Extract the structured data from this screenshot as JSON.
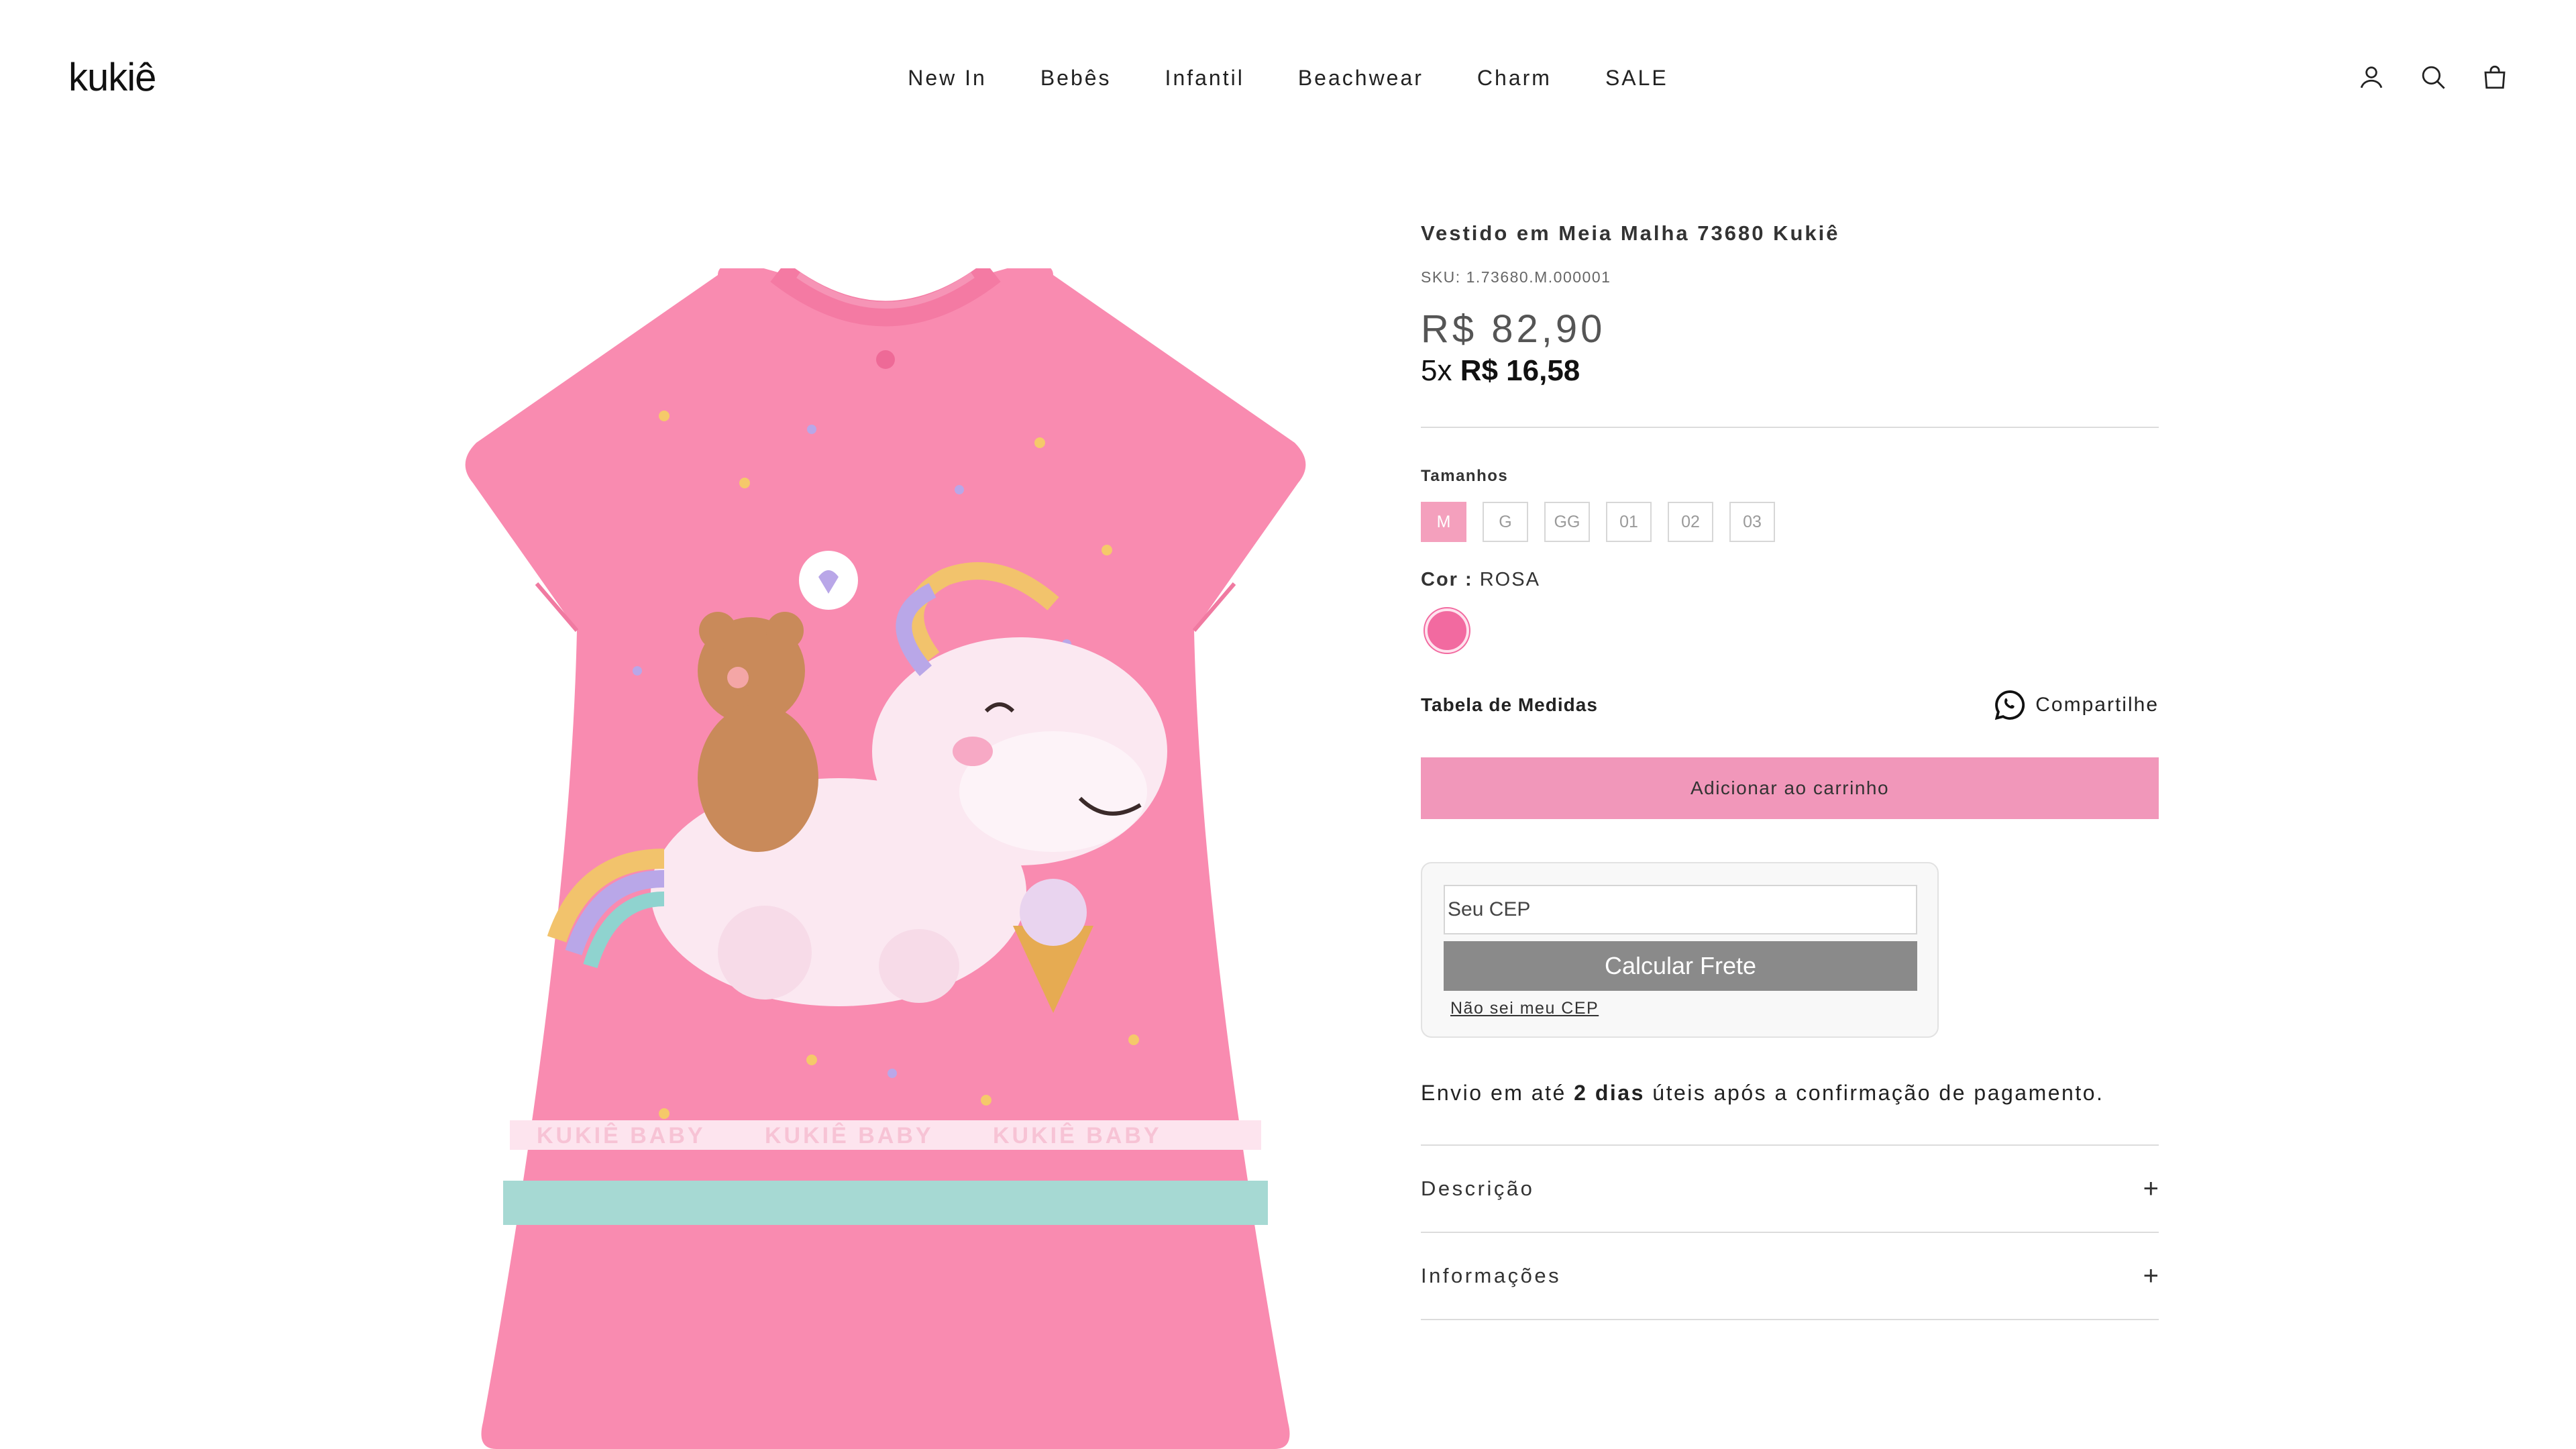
{
  "header": {
    "logo": "kukiê",
    "nav": [
      "New In",
      "Bebês",
      "Infantil",
      "Beachwear",
      "Charm",
      "SALE"
    ],
    "icons": [
      "account-icon",
      "search-icon",
      "cart-icon"
    ]
  },
  "product": {
    "title": "Vestido em Meia Malha 73680 Kukiê",
    "sku": "SKU: 1.73680.M.000001",
    "price": "R$ 82,90",
    "installments_prefix": "5x ",
    "installments_value": "R$ 16,58",
    "sizes_label": "Tamanhos",
    "sizes": [
      "M",
      "G",
      "GG",
      "01",
      "02",
      "03"
    ],
    "selected_size": "M",
    "color_label": "Cor :",
    "color_value": "ROSA",
    "swatch_color": "#f26aa0",
    "image_print_text": "KUKIÊ BABY"
  },
  "tools": {
    "size_chart": "Tabela de Medidas",
    "share": "Compartilhe"
  },
  "cart": {
    "add_label": "Adicionar ao carrinho",
    "button_color": "#f197ba"
  },
  "shipping": {
    "placeholder": "Seu CEP",
    "calc_label": "Calcular Frete",
    "unknown_cep": "Não sei meu CEP"
  },
  "delivery": {
    "prefix": "Envio em até ",
    "bold": "2 dias",
    "suffix": " úteis após a confirmação de pagamento."
  },
  "accordion": [
    "Descrição",
    "Informações"
  ]
}
